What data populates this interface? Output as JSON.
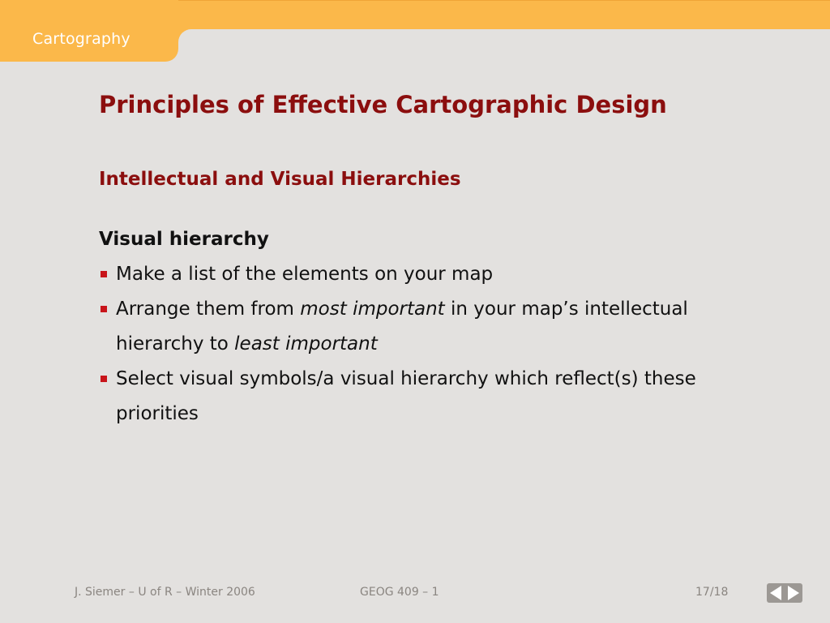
{
  "header": {
    "section_label": "Cartography"
  },
  "slide": {
    "title": "Principles of Effective Cartographic Design",
    "subtitle": "Intellectual and Visual Hierarchies",
    "heading": "Visual hierarchy",
    "bullets": [
      {
        "text": "Make a list of the elements on your map"
      },
      {
        "pre": "Arrange them from ",
        "em1": "most important",
        "mid": " in your map’s intellectual hierarchy to ",
        "em2": "least important"
      },
      {
        "text": "Select visual symbols/a visual hierarchy which reflect(s) these priorities"
      }
    ]
  },
  "footer": {
    "author": "J. Siemer – U of R – Winter 2006",
    "course": "GEOG 409 – 1",
    "page": "17/18"
  },
  "colors": {
    "accent": "#fbb84a",
    "title": "#8b0e0e",
    "bullet": "#c8141a",
    "background": "#e3e1df"
  },
  "icons": {
    "prev": "triangle-left-icon",
    "next": "triangle-right-icon"
  }
}
